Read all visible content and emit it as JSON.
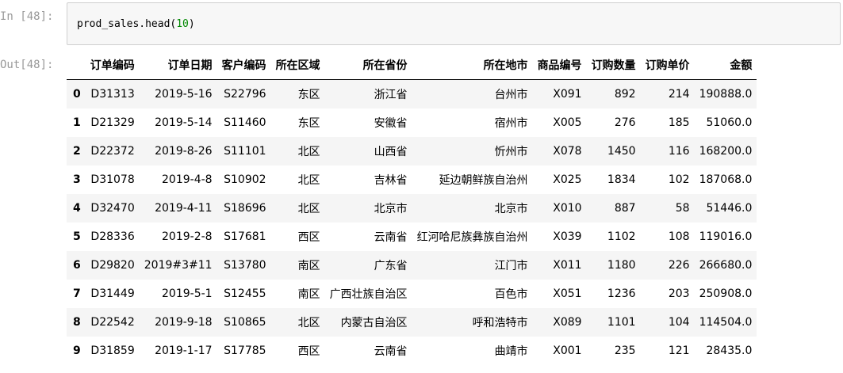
{
  "cell": {
    "in_prompt": "In [48]:",
    "out_prompt": "Out[48]:",
    "code_func": "prod_sales.head(",
    "code_arg": "10",
    "code_close": ")"
  },
  "table": {
    "columns": [
      "",
      "订单编码",
      "订单日期",
      "客户编码",
      "所在区域",
      "所在省份",
      "所在地市",
      "商品编号",
      "订购数量",
      "订购单价",
      "金额"
    ],
    "rows": [
      [
        "0",
        "D31313",
        "2019-5-16",
        "S22796",
        "东区",
        "浙江省",
        "台州市",
        "X091",
        "892",
        "214",
        "190888.0"
      ],
      [
        "1",
        "D21329",
        "2019-5-14",
        "S11460",
        "东区",
        "安徽省",
        "宿州市",
        "X005",
        "276",
        "185",
        "51060.0"
      ],
      [
        "2",
        "D22372",
        "2019-8-26",
        "S11101",
        "北区",
        "山西省",
        "忻州市",
        "X078",
        "1450",
        "116",
        "168200.0"
      ],
      [
        "3",
        "D31078",
        "2019-4-8",
        "S10902",
        "北区",
        "吉林省",
        "延边朝鲜族自治州",
        "X025",
        "1834",
        "102",
        "187068.0"
      ],
      [
        "4",
        "D32470",
        "2019-4-11",
        "S18696",
        "北区",
        "北京市",
        "北京市",
        "X010",
        "887",
        "58",
        "51446.0"
      ],
      [
        "5",
        "D28336",
        "2019-2-8",
        "S17681",
        "西区",
        "云南省",
        "红河哈尼族彝族自治州",
        "X039",
        "1102",
        "108",
        "119016.0"
      ],
      [
        "6",
        "D29820",
        "2019#3#11",
        "S13780",
        "南区",
        "广东省",
        "江门市",
        "X011",
        "1180",
        "226",
        "266680.0"
      ],
      [
        "7",
        "D31449",
        "2019-5-1",
        "S12455",
        "南区",
        "广西壮族自治区",
        "百色市",
        "X051",
        "1236",
        "203",
        "250908.0"
      ],
      [
        "8",
        "D22542",
        "2019-9-18",
        "S10865",
        "北区",
        "内蒙古自治区",
        "呼和浩特市",
        "X089",
        "1101",
        "104",
        "114504.0"
      ],
      [
        "9",
        "D31859",
        "2019-1-17",
        "S17785",
        "西区",
        "云南省",
        "曲靖市",
        "X001",
        "235",
        "121",
        "28435.0"
      ]
    ]
  }
}
